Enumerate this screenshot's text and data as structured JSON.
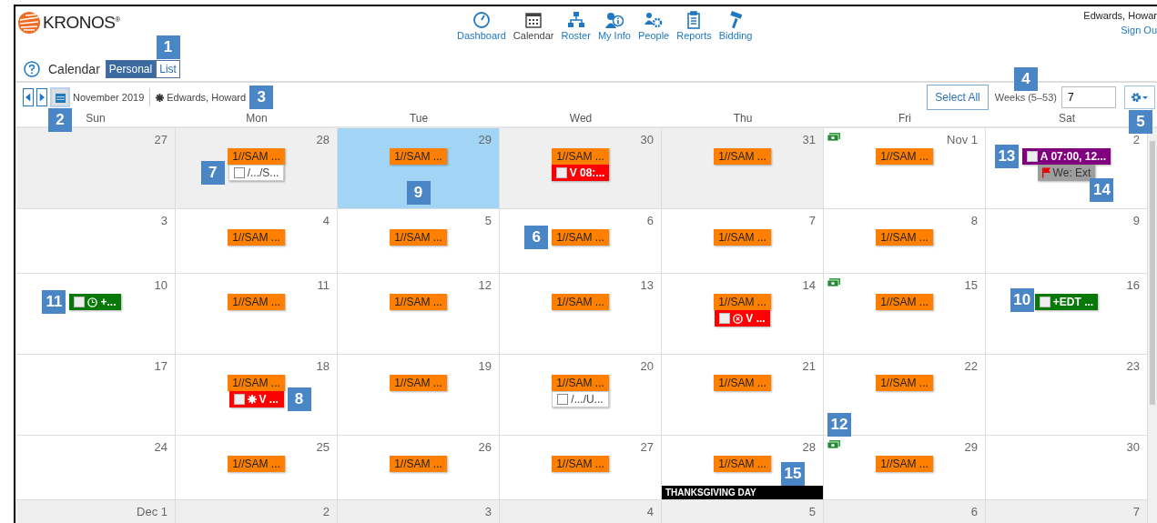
{
  "logo": {
    "text": "KRONOS$^{®}$"
  },
  "nav": [
    {
      "label": "Dashboard",
      "selected": false
    },
    {
      "label": "Calendar",
      "selected": true
    },
    {
      "label": "Roster",
      "selected": false
    },
    {
      "label": "My Info",
      "selected": false
    },
    {
      "label": "People",
      "selected": false
    },
    {
      "label": "Reports",
      "selected": false
    },
    {
      "label": "Bidding",
      "selected": false
    }
  ],
  "user": {
    "name": "Edwards, Howar",
    "sign_out": "Sign Ou"
  },
  "page_title": "Calendar",
  "tabs": [
    {
      "label": "Personal",
      "selected": true
    },
    {
      "label": "List",
      "selected": false,
      "callout": "1"
    }
  ],
  "toolbar": {
    "month": "November 2019",
    "calendar_callout": "2",
    "employee": "Edwards, Howard",
    "employee_callout": "3",
    "select_all": "Select All",
    "weeks_label": "Weeks (5–53)",
    "weeks_callout": "4",
    "weeks_value": "7",
    "settings_callout": "5"
  },
  "weekdays": [
    "Sun",
    "Mon",
    "Tue",
    "Wed",
    "Thu",
    "Fri",
    "Sat"
  ],
  "weeks": [
    {
      "days": [
        {
          "date": "27",
          "shaded": true,
          "selected": false
        },
        {
          "date": "28",
          "shaded": true,
          "selected": false,
          "events": [
            {
              "kind": "shift",
              "text": "1//SAM ..."
            },
            {
              "kind": "note",
              "text": "/.../S...",
              "checked": false,
              "callout": "7"
            }
          ]
        },
        {
          "date": "29",
          "shaded": false,
          "selected": true,
          "callout": "9",
          "events": [
            {
              "kind": "shift",
              "text": "1//SAM ..."
            }
          ]
        },
        {
          "date": "30",
          "shaded": true,
          "selected": false,
          "events": [
            {
              "kind": "shift",
              "text": "1//SAM ..."
            },
            {
              "kind": "timeoff",
              "text": "V 08:...",
              "checked": false
            }
          ]
        },
        {
          "date": "31",
          "shaded": true,
          "selected": false,
          "events": [
            {
              "kind": "shift",
              "text": "1//SAM ..."
            }
          ]
        },
        {
          "date": "Nov 1",
          "shaded": false,
          "selected": false,
          "money": true,
          "events": [
            {
              "kind": "shift",
              "text": "1//SAM ..."
            }
          ]
        },
        {
          "date": "2",
          "shaded": false,
          "selected": false,
          "events": [
            {
              "kind": "availability",
              "text": "A 07:00, 12...",
              "checked": false,
              "callout": "13"
            },
            {
              "kind": "flag",
              "text": "We: Ext",
              "callout": "14"
            }
          ]
        }
      ]
    },
    {
      "days": [
        {
          "date": "3",
          "shaded": false,
          "selected": false
        },
        {
          "date": "4",
          "shaded": false,
          "selected": false,
          "events": [
            {
              "kind": "shift",
              "text": "1//SAM ..."
            }
          ]
        },
        {
          "date": "5",
          "shaded": false,
          "selected": false,
          "events": [
            {
              "kind": "shift",
              "text": "1//SAM ..."
            }
          ]
        },
        {
          "date": "6",
          "shaded": false,
          "selected": false,
          "events": [
            {
              "kind": "shift",
              "text": "1//SAM ...",
              "callout": "6"
            }
          ]
        },
        {
          "date": "7",
          "shaded": false,
          "selected": false,
          "events": [
            {
              "kind": "shift",
              "text": "1//SAM ..."
            }
          ]
        },
        {
          "date": "8",
          "shaded": false,
          "selected": false,
          "events": [
            {
              "kind": "shift",
              "text": "1//SAM ..."
            }
          ]
        },
        {
          "date": "9",
          "shaded": false,
          "selected": false
        }
      ]
    },
    {
      "days": [
        {
          "date": "10",
          "shaded": false,
          "selected": false,
          "events": [
            {
              "kind": "punch",
              "text": "+...",
              "checked": false,
              "callout": "11"
            }
          ]
        },
        {
          "date": "11",
          "shaded": false,
          "selected": false,
          "events": [
            {
              "kind": "shift",
              "text": "1//SAM ..."
            }
          ]
        },
        {
          "date": "12",
          "shaded": false,
          "selected": false,
          "events": [
            {
              "kind": "shift",
              "text": "1//SAM ..."
            }
          ]
        },
        {
          "date": "13",
          "shaded": false,
          "selected": false,
          "events": [
            {
              "kind": "shift",
              "text": "1//SAM ..."
            }
          ]
        },
        {
          "date": "14",
          "shaded": false,
          "selected": false,
          "events": [
            {
              "kind": "shift",
              "text": "1//SAM ..."
            },
            {
              "kind": "cancelled",
              "text": "V ...",
              "checked": false
            }
          ]
        },
        {
          "date": "15",
          "shaded": false,
          "selected": false,
          "money": true,
          "events": [
            {
              "kind": "shift",
              "text": "1//SAM ..."
            }
          ]
        },
        {
          "date": "16",
          "shaded": false,
          "selected": false,
          "events": [
            {
              "kind": "pay",
              "text": "+EDT ...",
              "checked": false,
              "callout": "10"
            }
          ]
        }
      ]
    },
    {
      "days": [
        {
          "date": "17",
          "shaded": false,
          "selected": false
        },
        {
          "date": "18",
          "shaded": false,
          "selected": false,
          "events": [
            {
              "kind": "shift",
              "text": "1//SAM ..."
            },
            {
              "kind": "pending",
              "text": "V ...",
              "checked": false,
              "callout": "8"
            }
          ]
        },
        {
          "date": "19",
          "shaded": false,
          "selected": false,
          "events": [
            {
              "kind": "shift",
              "text": "1//SAM ..."
            }
          ]
        },
        {
          "date": "20",
          "shaded": false,
          "selected": false,
          "events": [
            {
              "kind": "shift",
              "text": "1//SAM ..."
            },
            {
              "kind": "note",
              "text": "/.../U...",
              "checked": false
            }
          ]
        },
        {
          "date": "21",
          "shaded": false,
          "selected": false,
          "events": [
            {
              "kind": "shift",
              "text": "1//SAM ..."
            }
          ]
        },
        {
          "date": "22",
          "shaded": false,
          "selected": false,
          "callout": "12",
          "events": [
            {
              "kind": "shift",
              "text": "1//SAM ..."
            }
          ]
        },
        {
          "date": "23",
          "shaded": false,
          "selected": false
        }
      ]
    },
    {
      "days": [
        {
          "date": "24",
          "shaded": false,
          "selected": false
        },
        {
          "date": "25",
          "shaded": false,
          "selected": false,
          "events": [
            {
              "kind": "shift",
              "text": "1//SAM ..."
            }
          ]
        },
        {
          "date": "26",
          "shaded": false,
          "selected": false,
          "events": [
            {
              "kind": "shift",
              "text": "1//SAM ..."
            }
          ]
        },
        {
          "date": "27",
          "shaded": false,
          "selected": false,
          "events": [
            {
              "kind": "shift",
              "text": "1//SAM ..."
            }
          ]
        },
        {
          "date": "28",
          "shaded": false,
          "selected": false,
          "holiday": {
            "text": "THANKSGIVING DAY",
            "callout": "15"
          },
          "events": [
            {
              "kind": "shift",
              "text": "1//SAM ..."
            }
          ]
        },
        {
          "date": "29",
          "shaded": false,
          "selected": false,
          "money": true,
          "events": [
            {
              "kind": "shift",
              "text": "1//SAM ..."
            }
          ]
        },
        {
          "date": "30",
          "shaded": false,
          "selected": false
        }
      ]
    },
    {
      "days": [
        {
          "date": "Dec 1",
          "shaded": true,
          "selected": false
        },
        {
          "date": "2",
          "shaded": true,
          "selected": false
        },
        {
          "date": "3",
          "shaded": true,
          "selected": false
        },
        {
          "date": "4",
          "shaded": true,
          "selected": false
        },
        {
          "date": "5",
          "shaded": true,
          "selected": false
        },
        {
          "date": "6",
          "shaded": true,
          "selected": false
        },
        {
          "date": "7",
          "shaded": true,
          "selected": false
        }
      ]
    }
  ]
}
